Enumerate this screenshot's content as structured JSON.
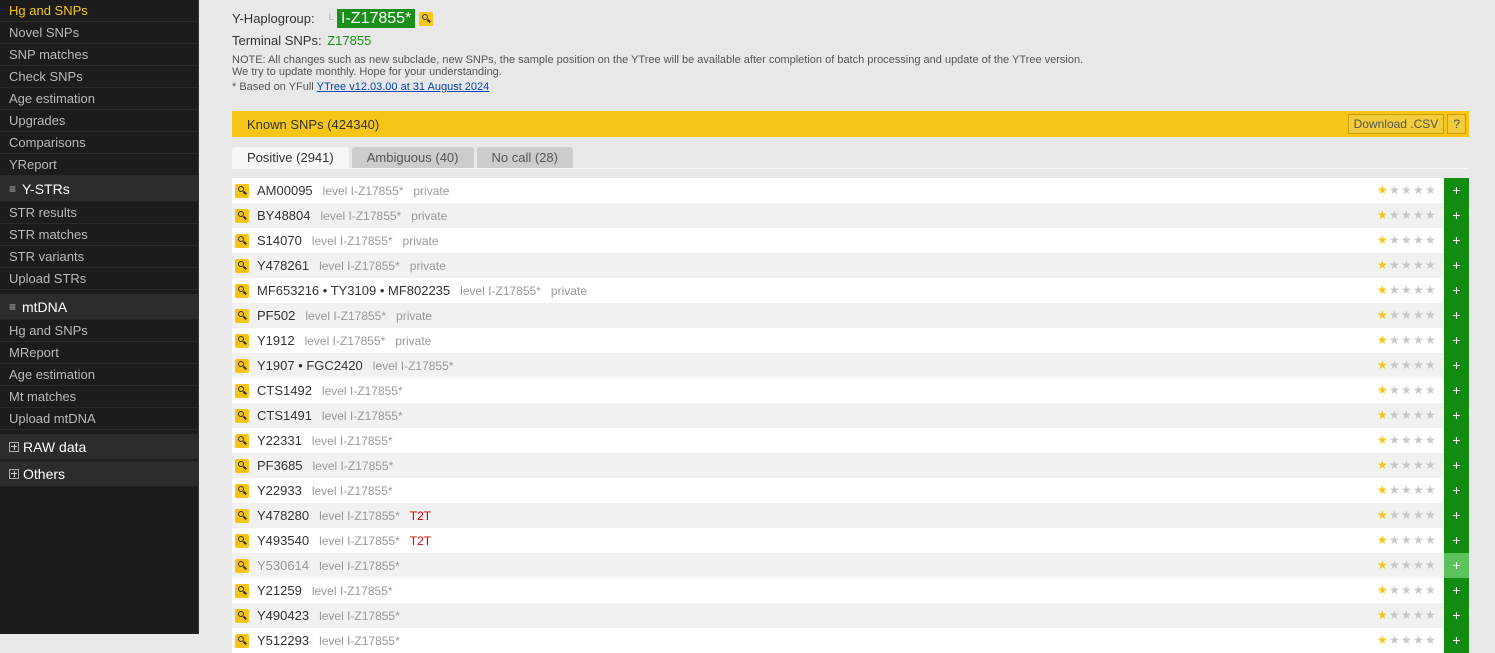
{
  "sidebar": {
    "ydna_items": [
      "Hg and SNPs",
      "Novel SNPs",
      "SNP matches",
      "Check SNPs",
      "Age estimation",
      "Upgrades",
      "Comparisons",
      "YReport"
    ],
    "ystr_header": "Y-STRs",
    "ystr_items": [
      "STR results",
      "STR matches",
      "STR variants",
      "Upload STRs"
    ],
    "mtdna_header": "mtDNA",
    "mtdna_items": [
      "Hg and SNPs",
      "MReport",
      "Age estimation",
      "Mt matches",
      "Upload mtDNA"
    ],
    "raw_header": "RAW data",
    "others_header": "Others"
  },
  "header": {
    "haplogroup_label": "Y-Haplogroup:",
    "haplogroup_value": "I-Z17855*",
    "terminal_label": "Terminal SNPs:",
    "terminal_value": "Z17855",
    "note_line1": "NOTE: All changes such as new subclade, new SNPs, the sample position on the YTree will be available after completion of batch processing and update of the YTree version.",
    "note_line2": "We try to update monthly. Hope for your understanding.",
    "based_prefix": "* Based on YFull",
    "based_link": "YTree v12.03.00 at 31 August 2024"
  },
  "known_bar": {
    "title": "Known SNPs (424340)",
    "download_label": "Download .CSV",
    "help_label": "?"
  },
  "tabs": [
    {
      "label": "Positive (2941)",
      "active": true
    },
    {
      "label": "Ambiguous (40)",
      "active": false
    },
    {
      "label": "No call (28)",
      "active": false
    }
  ],
  "rows": [
    {
      "name": "AM00095",
      "level": "level I-Z17855*",
      "private": "private",
      "t2t": "",
      "dim": false
    },
    {
      "name": "BY48804",
      "level": "level I-Z17855*",
      "private": "private",
      "t2t": "",
      "dim": false
    },
    {
      "name": "S14070",
      "level": "level I-Z17855*",
      "private": "private",
      "t2t": "",
      "dim": false
    },
    {
      "name": "Y478261",
      "level": "level I-Z17855*",
      "private": "private",
      "t2t": "",
      "dim": false
    },
    {
      "name": "MF653216 • TY3109 • MF802235",
      "level": "level I-Z17855*",
      "private": "private",
      "t2t": "",
      "dim": false
    },
    {
      "name": "PF502",
      "level": "level I-Z17855*",
      "private": "private",
      "t2t": "",
      "dim": false
    },
    {
      "name": "Y1912",
      "level": "level I-Z17855*",
      "private": "private",
      "t2t": "",
      "dim": false
    },
    {
      "name": "Y1907 • FGC2420",
      "level": "level I-Z17855*",
      "private": "",
      "t2t": "",
      "dim": false
    },
    {
      "name": "CTS1492",
      "level": "level I-Z17855*",
      "private": "",
      "t2t": "",
      "dim": false
    },
    {
      "name": "CTS1491",
      "level": "level I-Z17855*",
      "private": "",
      "t2t": "",
      "dim": false
    },
    {
      "name": "Y22331",
      "level": "level I-Z17855*",
      "private": "",
      "t2t": "",
      "dim": false
    },
    {
      "name": "PF3685",
      "level": "level I-Z17855*",
      "private": "",
      "t2t": "",
      "dim": false
    },
    {
      "name": "Y22933",
      "level": "level I-Z17855*",
      "private": "",
      "t2t": "",
      "dim": false
    },
    {
      "name": "Y478280",
      "level": "level I-Z17855*",
      "private": "",
      "t2t": "T2T",
      "dim": false
    },
    {
      "name": "Y493540",
      "level": "level I-Z17855*",
      "private": "",
      "t2t": "T2T",
      "dim": false
    },
    {
      "name": "Y530614",
      "level": "level I-Z17855*",
      "private": "",
      "t2t": "",
      "dim": true
    },
    {
      "name": "Y21259",
      "level": "level I-Z17855*",
      "private": "",
      "t2t": "",
      "dim": false
    },
    {
      "name": "Y490423",
      "level": "level I-Z17855*",
      "private": "",
      "t2t": "",
      "dim": false
    },
    {
      "name": "Y512293",
      "level": "level I-Z17855*",
      "private": "",
      "t2t": "",
      "dim": false
    }
  ],
  "row_rating": 1,
  "row_rating_max": 5,
  "add_label": "+",
  "icons": {
    "search": "magnifier-icon",
    "star": "star-icon",
    "list": "list-icon",
    "expand": "plus-box-icon"
  },
  "colors": {
    "accent": "#f5c518",
    "haplogroup_badge": "#1a8f1a",
    "add_button": "#118c11",
    "t2t": "#d40000"
  }
}
